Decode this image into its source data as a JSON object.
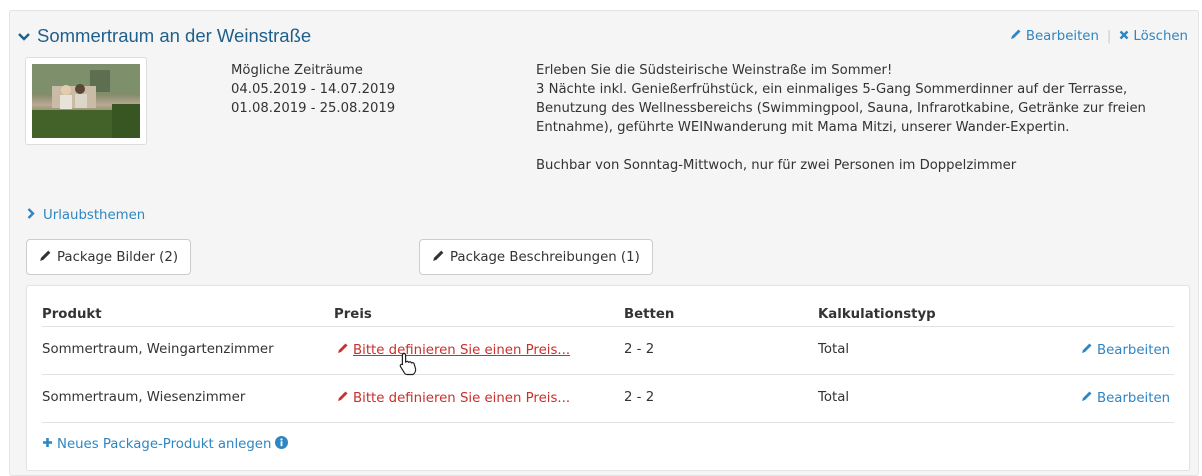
{
  "package": {
    "title": "Sommertraum an der Weinstraße",
    "edit_label": "Bearbeiten",
    "delete_label": "Löschen",
    "zeitraum_label": "Mögliche Zeiträume",
    "zeitraeume": [
      "04.05.2019 - 14.07.2019",
      "01.08.2019 - 25.08.2019"
    ],
    "description_lines": [
      "Erleben Sie die Südsteirische Weinstraße im Sommer!",
      "3 Nächte inkl. Genießerfrühstück, ein einmaliges 5-Gang Sommerdinner auf der Terrasse,",
      "Benutzung des Wellnessbereichs (Swimmingpool, Sauna, Infrarotkabine, Getränke zur freien",
      "Entnahme), geführte WEINwanderung mit Mama Mitzi, unserer Wander-Expertin."
    ],
    "description_footer": "Buchbar von Sonntag-Mittwoch, nur für zwei Personen im Doppelzimmer",
    "themen_label": "Urlaubsthemen",
    "bilder_button": "Package Bilder (2)",
    "beschreibungen_button": "Package Beschreibungen (1)"
  },
  "table": {
    "headers": [
      "Produkt",
      "Preis",
      "Betten",
      "Kalkulationstyp"
    ],
    "rows": [
      {
        "produkt": "Sommertraum, Weingartenzimmer",
        "preis": "Bitte definieren Sie einen Preis...",
        "betten": "2 - 2",
        "kalkulation": "Total",
        "edit": "Bearbeiten"
      },
      {
        "produkt": "Sommertraum, Wiesenzimmer",
        "preis": "Bitte definieren Sie einen Preis...",
        "betten": "2 - 2",
        "kalkulation": "Total",
        "edit": "Bearbeiten"
      }
    ],
    "new_link": "Neues Package-Produkt anlegen"
  },
  "colors": {
    "link": "#2f86c1",
    "title": "#1e5f8c",
    "danger": "#c9302c"
  }
}
